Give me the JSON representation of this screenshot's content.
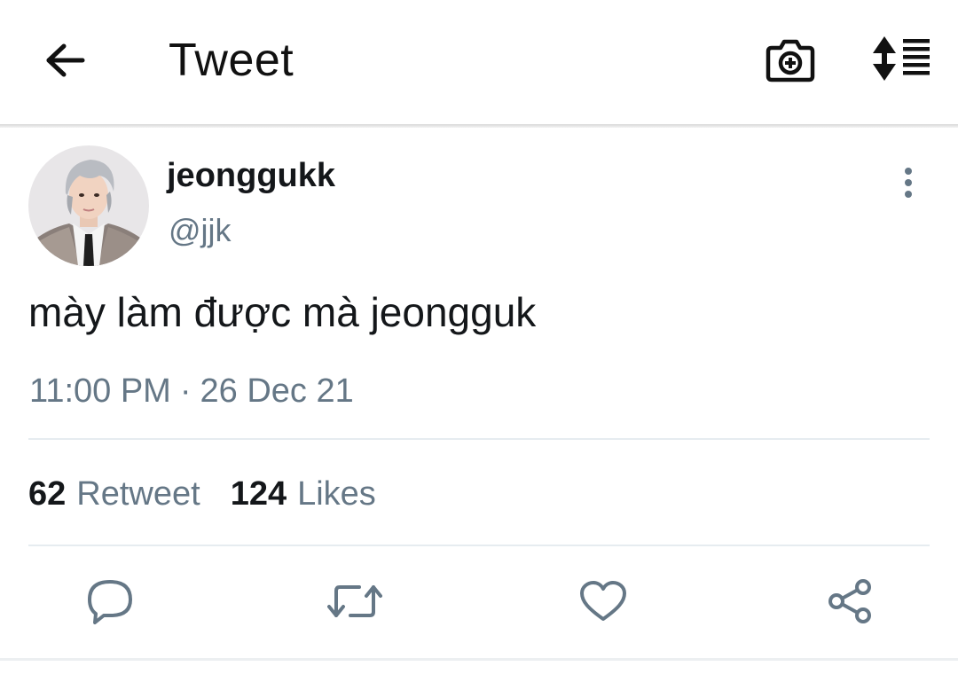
{
  "header": {
    "title": "Tweet",
    "back_icon": "arrow-left-icon",
    "camera_icon": "camera-plus-icon",
    "sort_icon": "sort-list-icon"
  },
  "tweet": {
    "display_name": "jeonggukk",
    "handle": "@jjk",
    "text": "mày làm được mà jeongguk",
    "time": "11:00 PM",
    "separator": "·",
    "date": "26 Dec 21",
    "stats": {
      "retweets_count": "62",
      "retweets_label": "Retweet",
      "likes_count": "124",
      "likes_label": "Likes"
    }
  },
  "actions": {
    "reply_icon": "reply-bubble-icon",
    "retweet_icon": "retweet-icon",
    "like_icon": "heart-icon",
    "share_icon": "share-icon"
  },
  "colors": {
    "text_primary": "#14171a",
    "text_secondary": "#657786",
    "icon": "#657786",
    "divider": "#e6ecf0"
  }
}
